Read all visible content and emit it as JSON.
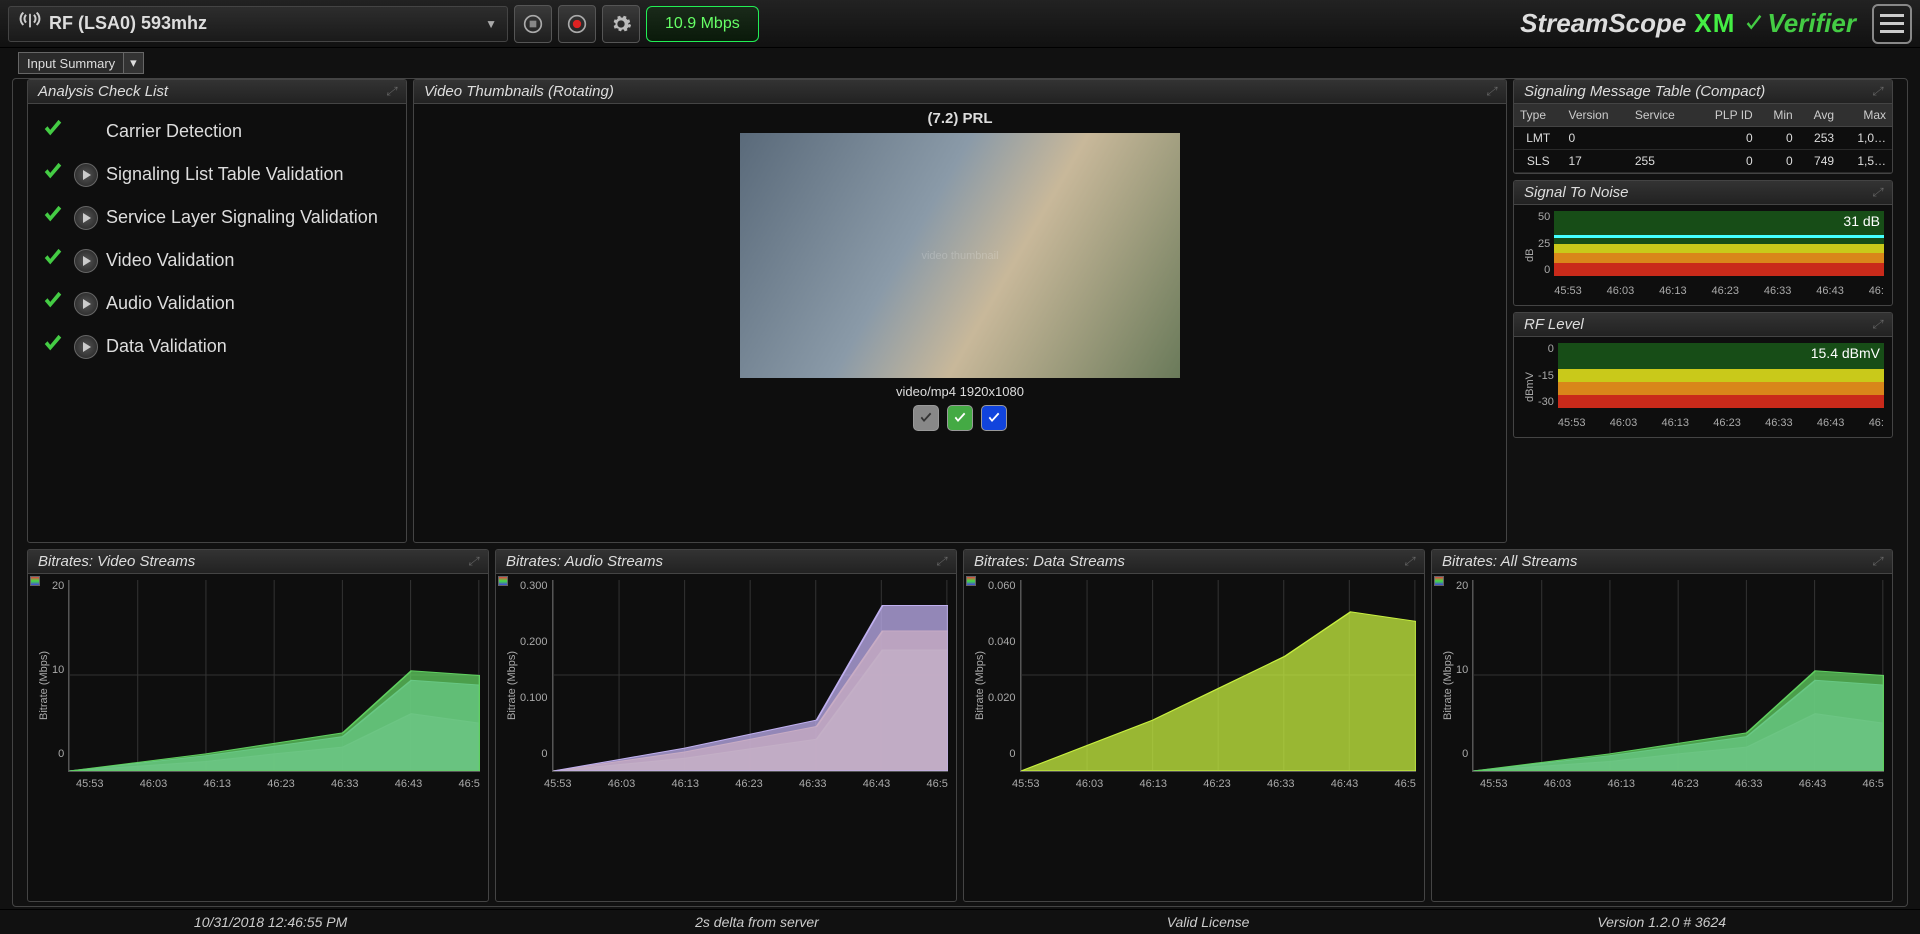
{
  "top": {
    "rf_source": "RF (LSA0) 593mhz",
    "bitrate": "10.9 Mbps",
    "brand": "StreamScope",
    "brand2": "XM",
    "brand3": "Verifier"
  },
  "subbar": {
    "dropdown": "Input Summary"
  },
  "checklist": {
    "title": "Analysis Check List",
    "items": [
      {
        "label": "Carrier Detection",
        "play": false
      },
      {
        "label": "Signaling List Table Validation",
        "play": true
      },
      {
        "label": "Service Layer Signaling Validation",
        "play": true
      },
      {
        "label": "Video Validation",
        "play": true
      },
      {
        "label": "Audio Validation",
        "play": true
      },
      {
        "label": "Data Validation",
        "play": true
      }
    ]
  },
  "video": {
    "title": "Video Thumbnails (Rotating)",
    "channel": "(7.2) PRL",
    "caption": "video/mp4 1920x1080"
  },
  "sigtable": {
    "title": "Signaling Message Table (Compact)",
    "headers": [
      "Type",
      "Version",
      "Service",
      "PLP ID",
      "Min",
      "Avg",
      "Max"
    ],
    "rows": [
      {
        "type": "LMT",
        "version": "0",
        "service": "",
        "plp": "0",
        "min": "0",
        "avg": "253",
        "max": "1,0…"
      },
      {
        "type": "SLS",
        "version": "17",
        "service": "255",
        "plp": "0",
        "min": "0",
        "avg": "749",
        "max": "1,5…"
      }
    ]
  },
  "snr": {
    "title": "Signal To Noise",
    "ylabel": "dB",
    "yticks": [
      "50",
      "25",
      "0"
    ],
    "value_label": "31 dB",
    "xticks": [
      "45:53",
      "46:03",
      "46:13",
      "46:23",
      "46:33",
      "46:43",
      "46:"
    ]
  },
  "chart_data": {
    "snr": {
      "type": "area",
      "ylim": [
        0,
        50
      ],
      "value": 31,
      "unit": "dB",
      "xticks": [
        "45:53",
        "46:03",
        "46:13",
        "46:23",
        "46:33",
        "46:43"
      ],
      "bands": [
        {
          "from": 0,
          "to": 10,
          "color": "#c92a1a"
        },
        {
          "from": 10,
          "to": 18,
          "color": "#d9861a"
        },
        {
          "from": 18,
          "to": 25,
          "color": "#c9c91a"
        },
        {
          "from": 25,
          "to": 50,
          "color": "#174d17"
        }
      ]
    },
    "rf": {
      "type": "area",
      "ylim": [
        -30,
        0
      ],
      "value": 15.4,
      "unit": "dBmV",
      "value_display": "15.4 dBmV",
      "xticks": [
        "45:53",
        "46:03",
        "46:13",
        "46:23",
        "46:33",
        "46:43"
      ],
      "bands": [
        {
          "from": -30,
          "to": -24,
          "color": "#c92a1a"
        },
        {
          "from": -24,
          "to": -18,
          "color": "#d9861a"
        },
        {
          "from": -18,
          "to": -12,
          "color": "#c9c91a"
        },
        {
          "from": -12,
          "to": 0,
          "color": "#174d17"
        }
      ]
    },
    "bitrates_video": {
      "type": "area",
      "ylabel": "Bitrate (Mbps)",
      "ylim": [
        0,
        20
      ],
      "yticks": [
        0,
        10,
        20
      ],
      "x": [
        "45:53",
        "46:03",
        "46:13",
        "46:23",
        "46:33",
        "46:43",
        "46:5"
      ],
      "series": [
        {
          "name": "violet",
          "color": "#c080e0",
          "values": [
            0,
            0.5,
            1,
            1.8,
            2.5,
            6,
            5
          ]
        },
        {
          "name": "blue",
          "color": "#80b0f0",
          "values": [
            0,
            0.8,
            1.6,
            2.6,
            3.6,
            9.5,
            9
          ]
        },
        {
          "name": "green",
          "color": "#60d060",
          "values": [
            0,
            0.9,
            1.8,
            2.9,
            4.0,
            10.5,
            10
          ]
        }
      ]
    },
    "bitrates_audio": {
      "type": "area",
      "ylabel": "Bitrate (Mbps)",
      "ylim": [
        0,
        0.3
      ],
      "yticks": [
        0.0,
        0.1,
        0.2,
        0.3
      ],
      "x": [
        "45:53",
        "46:03",
        "46:13",
        "46:23",
        "46:33",
        "46:43",
        "46:5"
      ],
      "series": [
        {
          "name": "green",
          "color": "#90d060",
          "values": [
            0,
            0.01,
            0.02,
            0.035,
            0.05,
            0.19,
            0.19
          ]
        },
        {
          "name": "orange",
          "color": "#e0a040",
          "values": [
            0,
            0.015,
            0.03,
            0.05,
            0.07,
            0.22,
            0.22
          ]
        },
        {
          "name": "lav",
          "color": "#c0b0f0",
          "values": [
            0,
            0.018,
            0.036,
            0.058,
            0.08,
            0.26,
            0.26
          ]
        }
      ]
    },
    "bitrates_data": {
      "type": "area",
      "ylabel": "Bitrate (Mbps)",
      "ylim": [
        0,
        0.06
      ],
      "yticks": [
        0,
        0.02,
        0.04,
        0.06
      ],
      "x": [
        "45:53",
        "46:03",
        "46:13",
        "46:23",
        "46:33",
        "46:43",
        "46:5"
      ],
      "series": [
        {
          "name": "lime",
          "color": "#c8f040",
          "values": [
            0,
            0.008,
            0.016,
            0.026,
            0.036,
            0.05,
            0.047
          ]
        }
      ]
    },
    "bitrates_all": {
      "type": "area",
      "ylabel": "Bitrate (Mbps)",
      "ylim": [
        0,
        20
      ],
      "yticks": [
        0,
        10,
        20
      ],
      "x": [
        "45:53",
        "46:03",
        "46:13",
        "46:23",
        "46:33",
        "46:43",
        "46:5"
      ],
      "series": [
        {
          "name": "violet",
          "color": "#c080e0",
          "values": [
            0,
            0.5,
            1,
            1.8,
            2.5,
            6,
            5
          ]
        },
        {
          "name": "blue",
          "color": "#80b0f0",
          "values": [
            0,
            0.8,
            1.6,
            2.6,
            3.6,
            9.5,
            9
          ]
        },
        {
          "name": "green",
          "color": "#60d060",
          "values": [
            0,
            0.9,
            1.8,
            2.9,
            4.0,
            10.5,
            10
          ]
        }
      ]
    }
  },
  "rf": {
    "title": "RF Level",
    "ylabel": "dBmV",
    "yticks": [
      "0",
      "-15",
      "-30"
    ],
    "value_label": "15.4 dBmV",
    "xticks": [
      "45:53",
      "46:03",
      "46:13",
      "46:23",
      "46:33",
      "46:43",
      "46:"
    ]
  },
  "br_panels": {
    "video": {
      "title": "Bitrates: Video Streams"
    },
    "audio": {
      "title": "Bitrates: Audio Streams"
    },
    "data": {
      "title": "Bitrates: Data Streams"
    },
    "all": {
      "title": "Bitrates: All Streams"
    }
  },
  "footer": {
    "time": "10/31/2018 12:46:55 PM",
    "delta": "2s delta from server",
    "license": "Valid License",
    "version": "Version 1.2.0 # 3624"
  }
}
